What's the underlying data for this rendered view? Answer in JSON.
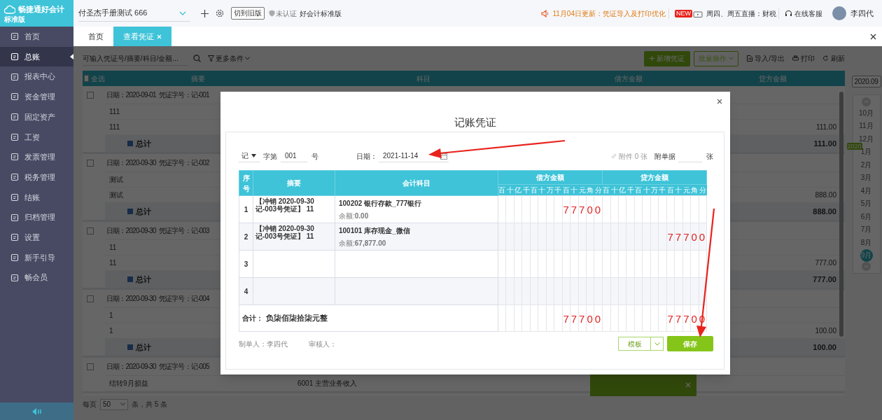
{
  "sidebar": {
    "logo_title": "畅捷通好会计",
    "logo_edition": "标准版",
    "items": [
      {
        "label": "首页",
        "selected": false
      },
      {
        "label": "总账",
        "selected": true
      },
      {
        "label": "报表中心",
        "selected": false
      },
      {
        "label": "资金管理",
        "selected": false
      },
      {
        "label": "固定资产",
        "selected": false
      },
      {
        "label": "工资",
        "selected": false
      },
      {
        "label": "发票管理",
        "selected": false
      },
      {
        "label": "税务管理",
        "selected": false
      },
      {
        "label": "结账",
        "selected": false
      },
      {
        "label": "归档管理",
        "selected": false
      },
      {
        "label": "设置",
        "selected": false
      },
      {
        "label": "新手引导",
        "selected": false
      },
      {
        "label": "畅会员",
        "selected": false
      }
    ]
  },
  "topbar": {
    "account": "付圣杰手册测试 666",
    "switch_button": "切到旧版",
    "cert_status": "未认证",
    "edition": "好会计标准版",
    "notice": "11月04日更新：凭证导入及打印优化",
    "live_badge": "NEW",
    "live_text": "周四、周五直播：财税",
    "support": "在线客服",
    "user": "李四代"
  },
  "tabs": [
    {
      "label": "首页",
      "selected": false,
      "closable": false
    },
    {
      "label": "查看凭证",
      "selected": true,
      "closable": true
    }
  ],
  "toolbar": {
    "search_placeholder": "可输入凭证号/摘要/科目/金额...",
    "filter": "更多条件",
    "buttons": [
      {
        "label": "新增凭证",
        "kind": "primary"
      },
      {
        "label": "批量操作",
        "kind": "dropdown"
      },
      {
        "label": "导入/导出",
        "kind": "import"
      },
      {
        "label": "打印",
        "kind": "print"
      },
      {
        "label": "刷新",
        "kind": "refresh"
      }
    ]
  },
  "list": {
    "columns": [
      "全选",
      "摘要",
      "科目",
      "借方金额",
      "贷方金额"
    ],
    "select_all_checked": false,
    "vouchers": [
      {
        "checked": false,
        "date": "日期：2020-09-01",
        "number": "凭证字号：记-001",
        "lines": [
          {
            "summary": "111"
          },
          {
            "summary": "111",
            "credit": "111.00"
          }
        ],
        "total_label": "总计",
        "total_credit": "111.00"
      },
      {
        "checked": false,
        "date": "日期：2020-09-30",
        "number": "凭证字号：记-002",
        "lines": [
          {
            "summary": "测试"
          },
          {
            "summary": "测试",
            "credit": "888.00"
          }
        ],
        "total_label": "总计",
        "total_credit": "888.00"
      },
      {
        "checked": false,
        "date": "日期：2020-09-30",
        "number": "凭证字号：记-003",
        "lines": [
          {
            "summary": "11"
          },
          {
            "summary": "11",
            "credit": "777.00"
          }
        ],
        "total_label": "总计",
        "total_credit": "777.00"
      },
      {
        "checked": false,
        "date": "日期：2020-09-30",
        "number": "凭证字号：记-004",
        "lines": [
          {
            "summary": "1"
          },
          {
            "summary": "1",
            "credit": "100.00"
          }
        ],
        "total_label": "总计",
        "total_credit": "100.00"
      },
      {
        "checked": false,
        "date": "日期：2020-09-30",
        "number": "凭证字号：记-005",
        "lines": [
          {
            "summary": "结转9月损益",
            "subject": "6001 主营业务收入"
          }
        ]
      }
    ],
    "pagination": {
      "per_page_label": "每页",
      "per_page": "50",
      "count": "条，共 5 条"
    }
  },
  "month_picker": {
    "period": "2020.09",
    "months": [
      {
        "label": "10月",
        "selected": false
      },
      {
        "label": "11月",
        "selected": false
      },
      {
        "label": "12月",
        "selected": false
      },
      {
        "label": "1月",
        "selected": false,
        "badge": "2020"
      },
      {
        "label": "2月",
        "selected": false
      },
      {
        "label": "3月",
        "selected": false
      },
      {
        "label": "4月",
        "selected": false
      },
      {
        "label": "5月",
        "selected": false
      },
      {
        "label": "6月",
        "selected": false
      },
      {
        "label": "7月",
        "selected": false
      },
      {
        "label": "8月",
        "selected": false
      },
      {
        "label": "9月",
        "selected": true
      }
    ]
  },
  "voucher_dialog": {
    "title": "记账凭证",
    "word": "记",
    "word_prefix": "字第",
    "number": "001",
    "number_suffix": "号",
    "date_label": "日期：",
    "date": "2021-11-14",
    "attachments": "附件 0 张",
    "docs_label": "附单据",
    "docs_unit": "张",
    "columns": {
      "index": "序号",
      "summary": "摘要",
      "subject": "会计科目",
      "debit": "借方金额",
      "credit": "贷方金额"
    },
    "debit_units": [
      "百",
      "十",
      "亿",
      "千",
      "百",
      "十",
      "万",
      "千",
      "百",
      "十",
      "元",
      "角",
      "分"
    ],
    "credit_units": [
      "百",
      "十",
      "亿",
      "千",
      "百",
      "十",
      "万",
      "千",
      "百",
      "十",
      "元",
      "角",
      "分"
    ],
    "rows": [
      {
        "index": "1",
        "summary": "【冲销 2020-09-30 记-003号凭证】 11",
        "subject": "100202 银行存款_777银行",
        "balance": "余额:**0.00**",
        "debit": "77700"
      },
      {
        "index": "2",
        "summary": "【冲销 2020-09-30 记-003号凭证】 11",
        "subject": "100101 库存现金_微信",
        "balance": "余额:**67,877.00**",
        "credit": "77700"
      },
      {
        "index": "3"
      },
      {
        "index": "4"
      }
    ],
    "total_label": "合计：",
    "total_words": "负柒佰柒拾柒元整",
    "total_debit": "77700",
    "total_credit": "77700",
    "maker": "制单人：李四代",
    "reviewer": "审核人：",
    "template_button": "模板",
    "save_button": "保存"
  }
}
